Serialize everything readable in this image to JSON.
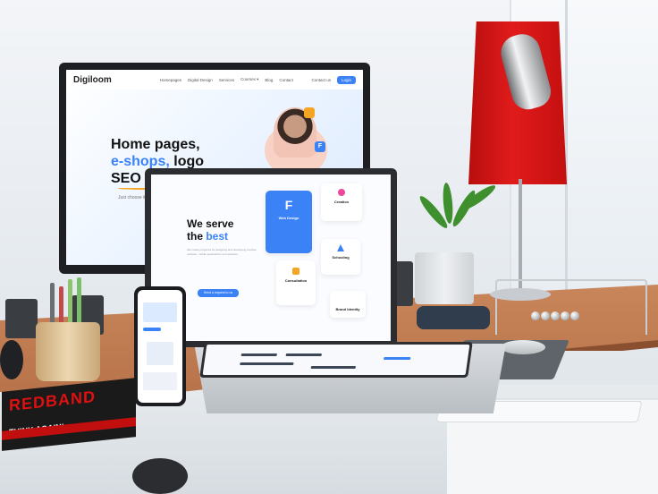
{
  "monitor": {
    "logo": "Digiloom",
    "nav": [
      "Homepages",
      "Digital Design",
      "Services",
      "Courses ▾",
      "Blog",
      "Contact"
    ],
    "nav_login": "Contact us",
    "nav_button": "Login",
    "hero_line1": "Home pages,",
    "hero_line2a": "e-shops,",
    "hero_line2b": " logo",
    "hero_line3": "SEO - you can",
    "hero_sub": "Just choose it!"
  },
  "laptop": {
    "heading1": "We serve",
    "heading2a": "the ",
    "heading2b": "best",
    "paragraph": "We create programs for designing and developing creative software, mobile applications and websites.",
    "button": "Send a request to us",
    "cards": {
      "web_design": "Web Design",
      "creation": "Creation",
      "schooling": "Schooling",
      "consultation": "Consultation",
      "brand_identity": "Brand Identity"
    }
  },
  "magazine": {
    "title": "REDBAND",
    "headline": "THINK AGAIN!"
  },
  "colors": {
    "accent_blue": "#3b82f6",
    "lamp_red": "#e11b1b",
    "desk": "#c9865a"
  }
}
